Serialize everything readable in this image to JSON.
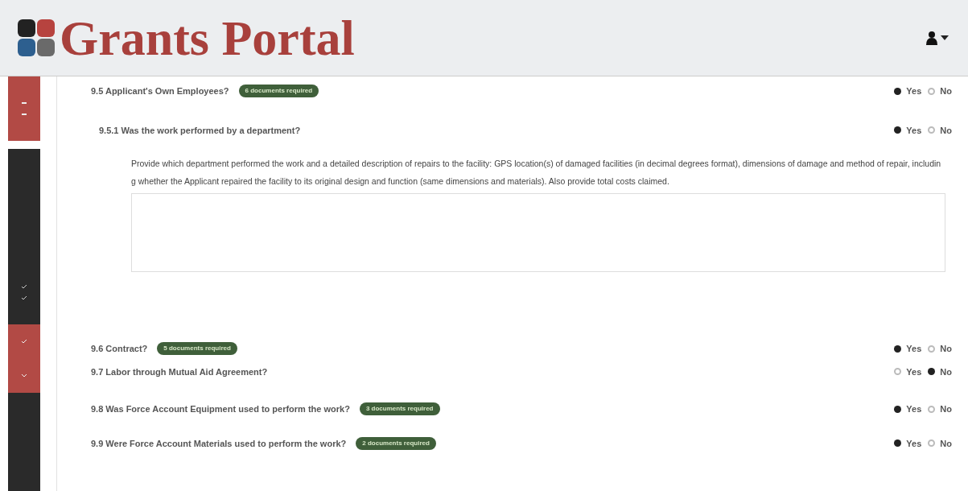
{
  "header": {
    "title": "Grants Portal"
  },
  "questions": [
    {
      "number": "9.5",
      "text": "Applicant's Own Employees?",
      "badge": "6 documents required",
      "options": [
        {
          "label": "Yes",
          "selected": true
        },
        {
          "label": "No",
          "selected": false
        }
      ],
      "children": [
        {
          "number": "9.5.1",
          "text": "Was the work performed by a department?",
          "options": [
            {
              "label": "Yes",
              "selected": true
            },
            {
              "label": "No",
              "selected": false
            }
          ],
          "prompt": "Provide which department performed the work and a detailed description of repairs to the facility: GPS location(s) of damaged facilities (in decimal degrees format), dimensions of damage and method of repair, including whether the Applicant repaired the facility to its original design and function (same dimensions and materials). Also provide total costs claimed."
        }
      ]
    },
    {
      "number": "9.6",
      "text": "Contract?",
      "badge": "5 documents required",
      "options": [
        {
          "label": "Yes",
          "selected": true
        },
        {
          "label": "No",
          "selected": false
        }
      ]
    },
    {
      "number": "9.7",
      "text": "Labor through Mutual Aid Agreement?",
      "options": [
        {
          "label": "Yes",
          "selected": false
        },
        {
          "label": "No",
          "selected": true
        }
      ]
    },
    {
      "number": "9.8",
      "text": "Was Force Account Equipment used to perform the work?",
      "badge": "3 documents required",
      "options": [
        {
          "label": "Yes",
          "selected": true
        },
        {
          "label": "No",
          "selected": false
        }
      ]
    },
    {
      "number": "9.9",
      "text": "Were Force Account Materials used to perform the work?",
      "badge": "2 documents required",
      "options": [
        {
          "label": "Yes",
          "selected": true
        },
        {
          "label": "No",
          "selected": false
        }
      ]
    }
  ]
}
